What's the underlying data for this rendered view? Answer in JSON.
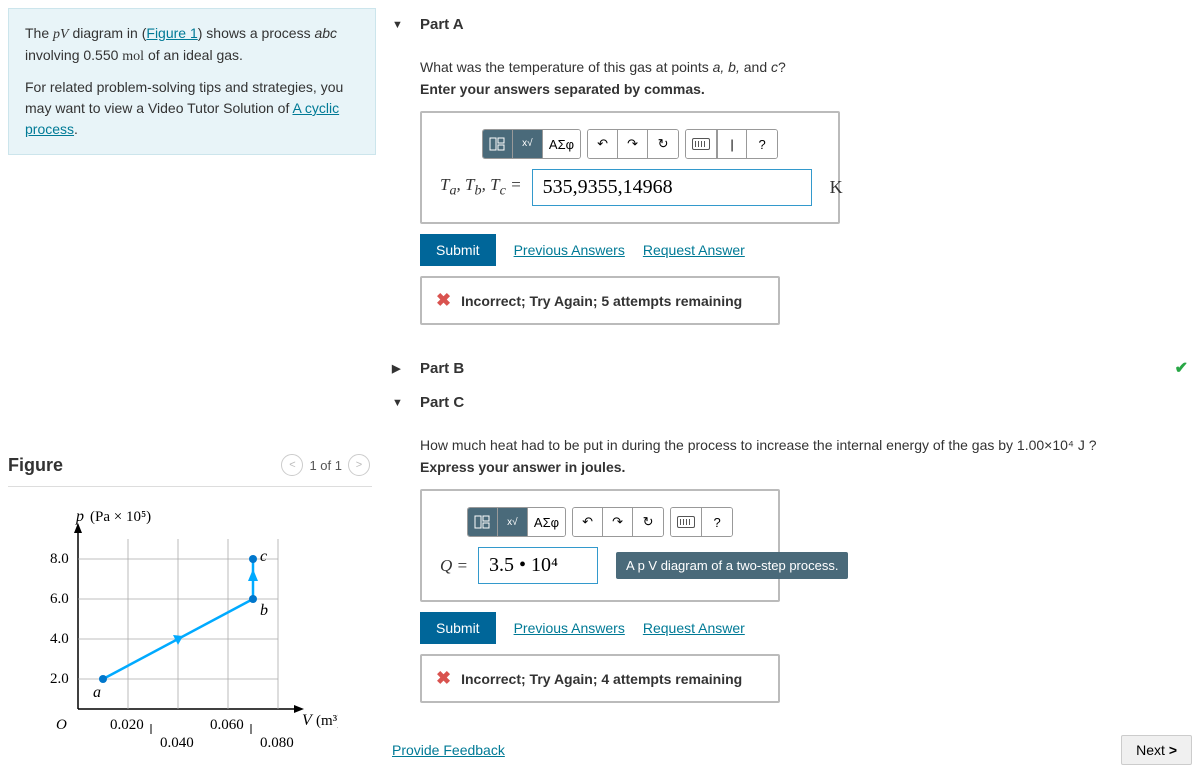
{
  "problem": {
    "line1_a": "The ",
    "line1_pv": "pV",
    "line1_b": " diagram in (",
    "figure_link": "Figure 1",
    "line1_c": ") shows a process ",
    "abc": "abc",
    "line1_d": " involving 0.550 ",
    "mol": "mol",
    "line1_e": " of an ideal gas.",
    "line2_a": "For related problem-solving tips and strategies, you may want to view a Video Tutor Solution of ",
    "cyclic_link": "A cyclic process",
    "line2_b": "."
  },
  "figure": {
    "title": "Figure",
    "pager": "1 of 1"
  },
  "partA": {
    "title": "Part A",
    "question_a": "What was the temperature of this gas at points ",
    "question_b": "a,",
    "question_c": " b,",
    "question_d": " and ",
    "question_e": "c",
    "question_f": "?",
    "instr": "Enter your answers separated by commas.",
    "label": "Tₐ, T_b, T_c =",
    "value": "535,9355,14968",
    "unit": "K",
    "submit": "Submit",
    "prev": "Previous Answers",
    "req": "Request Answer",
    "feedback": "Incorrect; Try Again; 5 attempts remaining"
  },
  "partB": {
    "title": "Part B"
  },
  "partC": {
    "title": "Part C",
    "question": "How much heat had to be put in during the process to increase the internal energy of the gas by 1.00×10⁴  J  ?",
    "instr": "Express your answer in joules.",
    "label": "Q =",
    "value": "3.5 • 10⁴",
    "tooltip": "A p V diagram of a two-step process.",
    "submit": "Submit",
    "prev": "Previous Answers",
    "req": "Request Answer",
    "feedback": "Incorrect; Try Again; 4 attempts remaining"
  },
  "toolbar": {
    "greek": "ΑΣφ",
    "help": "?"
  },
  "bottom": {
    "feedback": "Provide Feedback",
    "next": "Next"
  },
  "chart_data": {
    "type": "line",
    "title": "",
    "xlabel": "V (m³)",
    "ylabel": "p (Pa × 10⁵)",
    "xlim": [
      0,
      0.08
    ],
    "ylim": [
      0,
      8.0
    ],
    "x_ticks": [
      0,
      0.02,
      0.04,
      0.06,
      0.08
    ],
    "y_ticks": [
      2.0,
      4.0,
      6.0,
      8.0
    ],
    "points": [
      {
        "name": "a",
        "V": 0.01,
        "p": 2.0
      },
      {
        "name": "b",
        "V": 0.07,
        "p": 6.0
      },
      {
        "name": "c",
        "V": 0.07,
        "p": 8.0
      }
    ],
    "segments": [
      {
        "from": "a",
        "to": "b"
      },
      {
        "from": "b",
        "to": "c"
      }
    ]
  }
}
